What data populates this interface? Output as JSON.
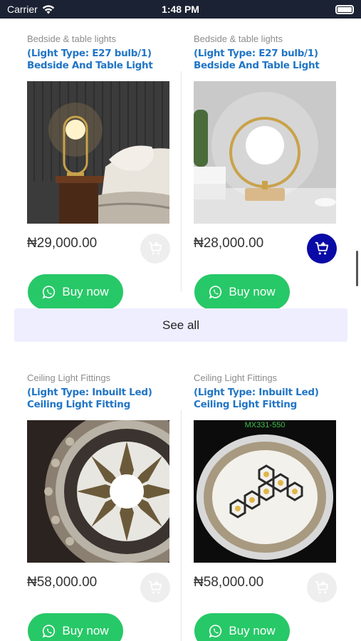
{
  "status_bar": {
    "carrier": "Carrier",
    "time": "1:48 PM"
  },
  "sections": [
    {
      "products": [
        {
          "category": "Bedside & table lights",
          "title": "(Light Type: E27 bulb/1) Bedside And Table Light",
          "price": "₦29,000.00",
          "buy_label": "Buy now",
          "cart_state": "disabled"
        },
        {
          "category": "Bedside & table lights",
          "title": "(Light Type: E27 bulb/1) Bedside And Table Light",
          "price": "₦28,000.00",
          "buy_label": "Buy now",
          "cart_state": "active"
        }
      ],
      "see_all": "See all"
    },
    {
      "products": [
        {
          "category": "Ceiling Light Fittings",
          "title": "(Light Type: Inbuilt Led) Ceiling Light Fitting",
          "price": "₦58,000.00",
          "buy_label": "Buy now",
          "cart_state": "disabled"
        },
        {
          "category": "Ceiling Light Fittings",
          "title": "(Light Type: Inbuilt Led) Ceiling Light Fitting",
          "price": "₦58,000.00",
          "buy_label": "Buy now",
          "cart_state": "disabled",
          "image_caption": "MX331-550"
        }
      ]
    }
  ],
  "colors": {
    "title": "#2175c5",
    "buy_button": "#27c867",
    "cart_active": "#0a0aa6",
    "see_all_bg": "#eeeeff"
  },
  "icons": {
    "cart": "add-to-cart-icon",
    "whatsapp": "whatsapp-icon",
    "wifi": "wifi-icon",
    "battery": "battery-icon"
  }
}
